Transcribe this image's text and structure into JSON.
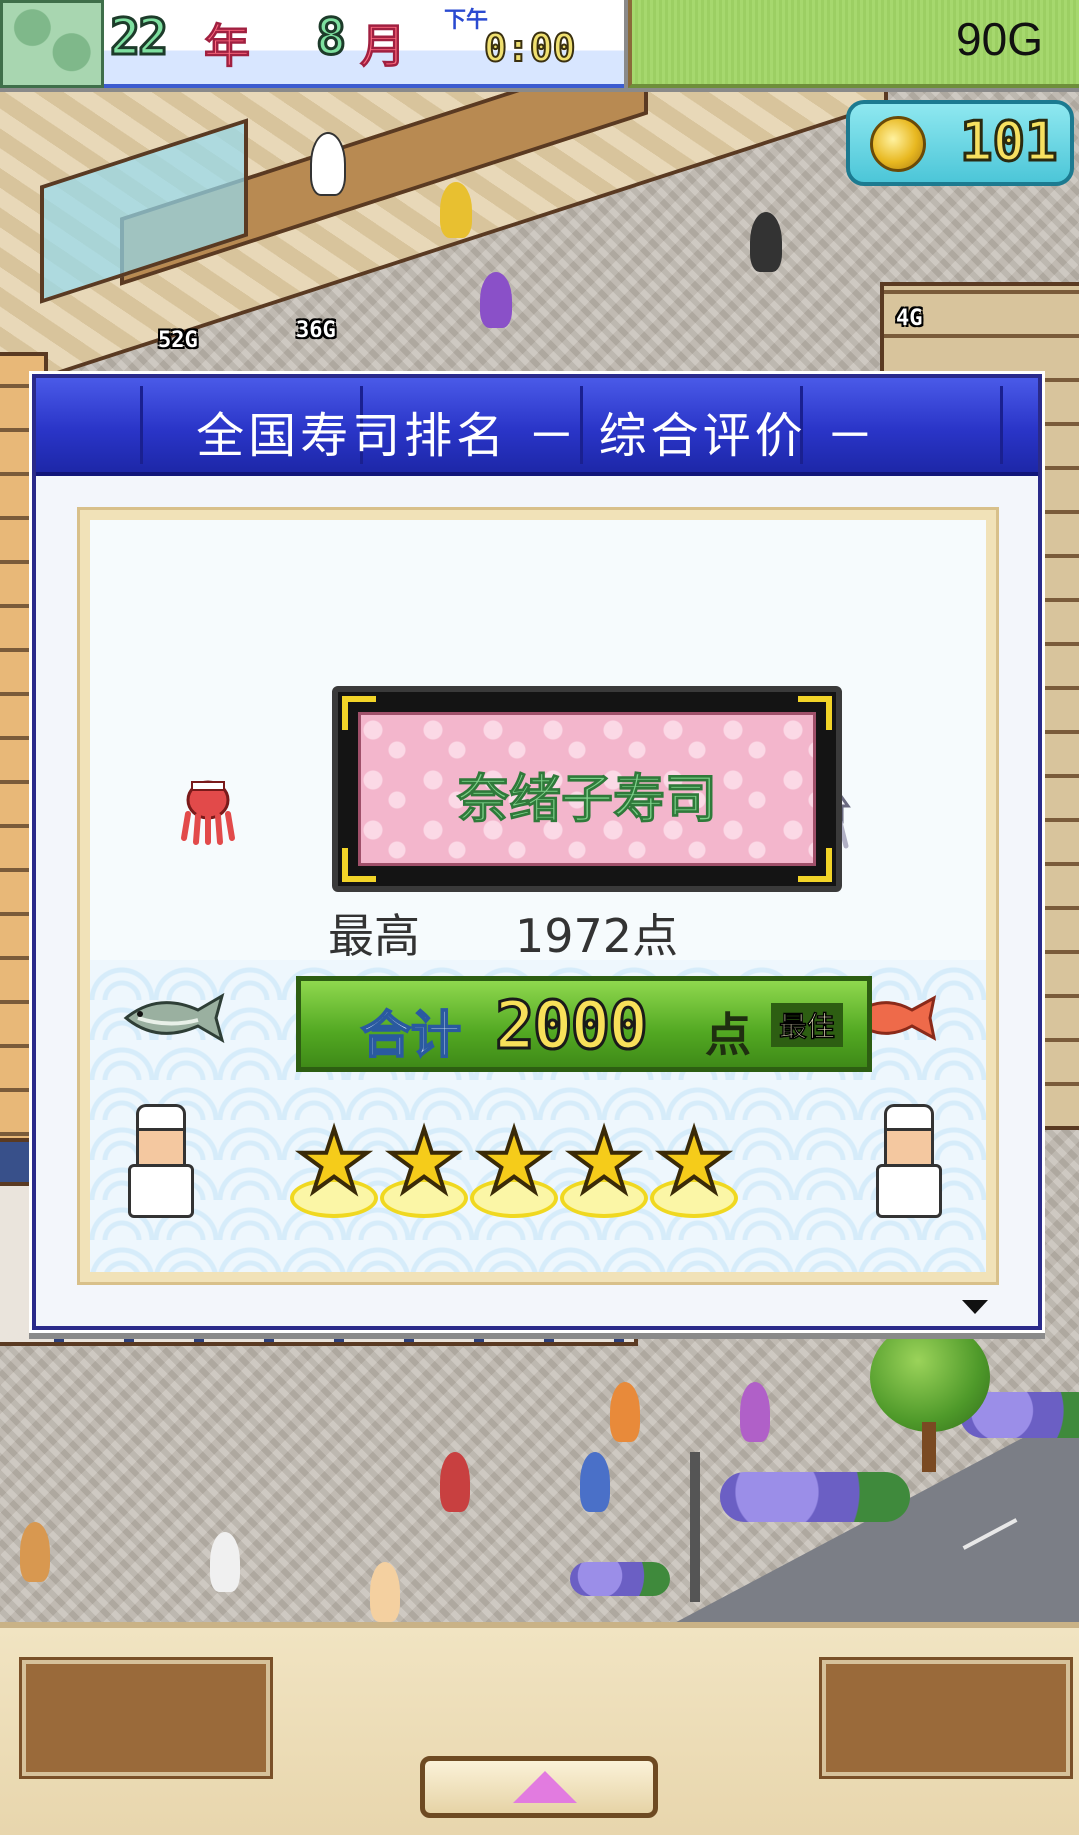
{
  "top_bar": {
    "year": "22",
    "year_unit": "年",
    "month": "8",
    "month_unit": "月",
    "period": "下午",
    "time": "0:00",
    "money": "90G"
  },
  "coin_counter": {
    "icon": "gold-coin-icon",
    "value": "101"
  },
  "scene_labels": {
    "income_left": "52G",
    "income_mid": "36G",
    "income_right": "4G"
  },
  "dialog": {
    "title": "全国寿司排名 － 综合评价 －",
    "shop_name": "奈绪子寿司",
    "best_label": "最高",
    "best_value": "1972点",
    "total_label": "合计",
    "total_value": "2000",
    "total_unit": "点",
    "total_badge": "最佳",
    "star_rating": 5,
    "star_max": 5,
    "icons": [
      "octopus-icon",
      "squid-icon",
      "fish-icon",
      "red-snapper-icon",
      "chef-icon"
    ]
  },
  "colors": {
    "header_blue": "#2a35c8",
    "total_green": "#52a822",
    "star_gold": "#f5cc1a",
    "plaque_pink": "#f3b6cc"
  },
  "bottom_bar": {
    "menu_toggle_icon": "up-arrow-icon"
  }
}
